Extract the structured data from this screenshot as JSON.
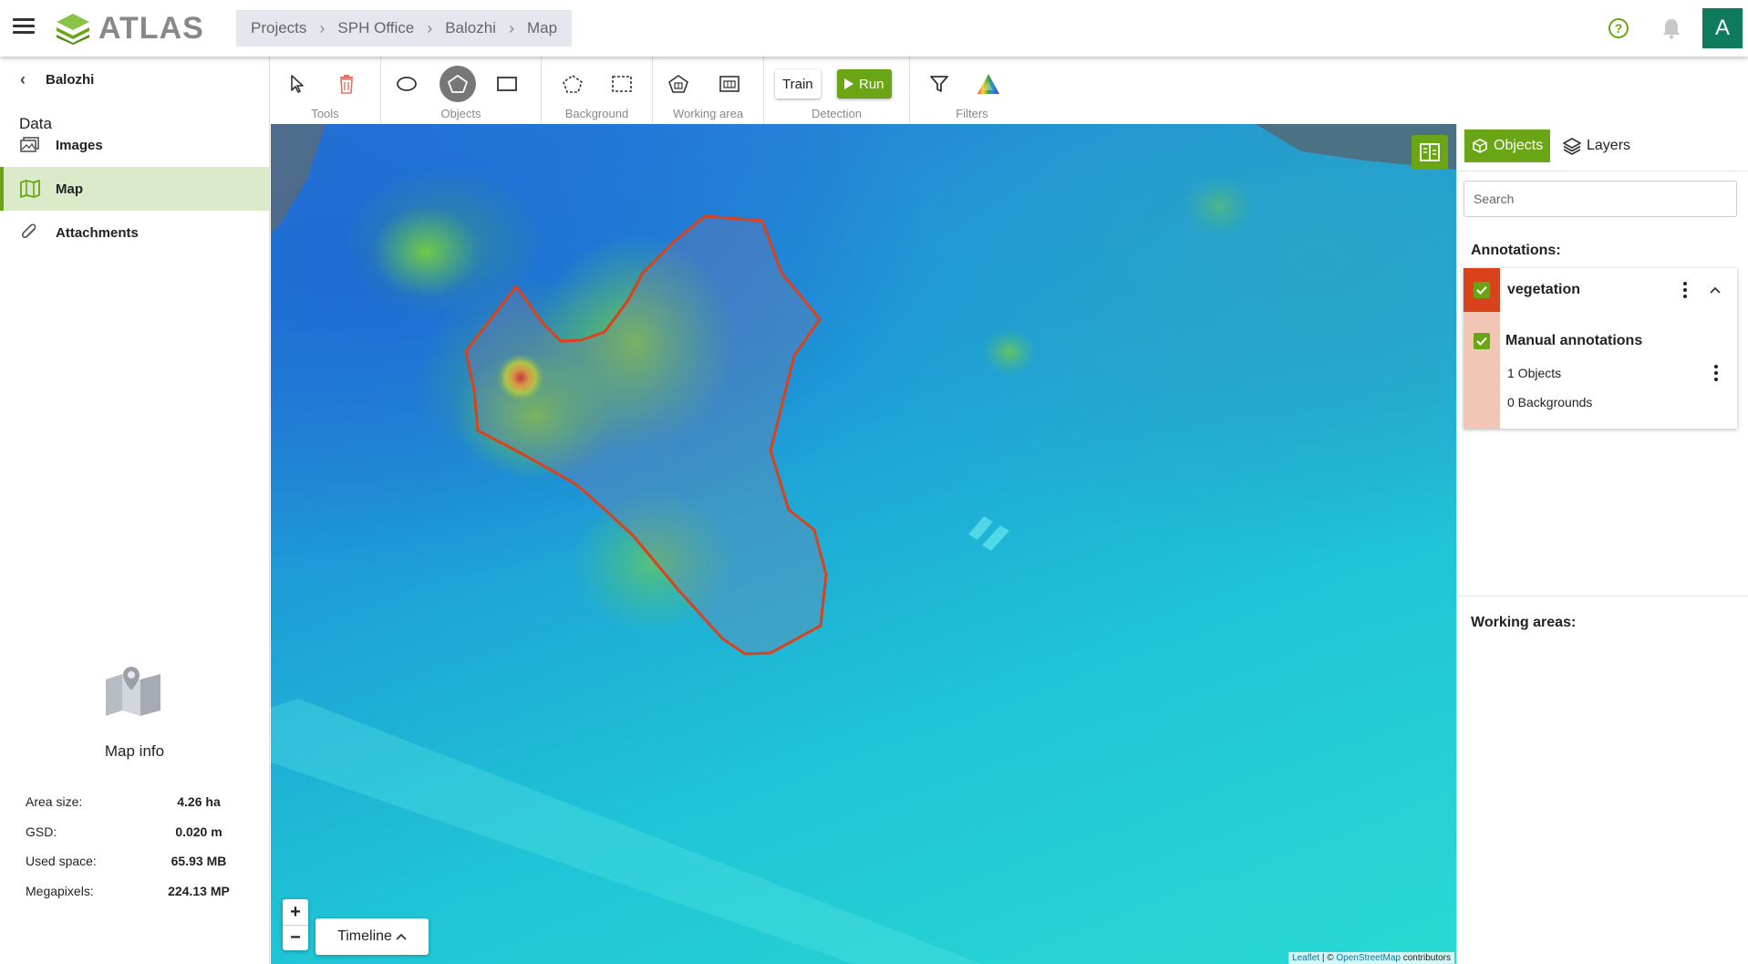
{
  "header": {
    "logo_text": "ATLAS",
    "breadcrumb": [
      "Projects",
      "SPH Office",
      "Balozhi",
      "Map"
    ],
    "help_icon": "help-circle-icon",
    "bell_icon": "bell-icon",
    "avatar_letter": "A",
    "accent_color": "#6aa515"
  },
  "sidebar": {
    "back_label": "Balozhi",
    "section_title": "Data",
    "items": [
      {
        "label": "Images",
        "icon": "images-icon",
        "active": false
      },
      {
        "label": "Map",
        "icon": "map-icon",
        "active": true
      },
      {
        "label": "Attachments",
        "icon": "paperclip-icon",
        "active": false
      }
    ],
    "map_info": {
      "title": "Map info",
      "stats": [
        {
          "label": "Area size:",
          "value": "4.26 ha"
        },
        {
          "label": "GSD:",
          "value": "0.020 m"
        },
        {
          "label": "Used space:",
          "value": "65.93 MB"
        },
        {
          "label": "Megapixels:",
          "value": "224.13 MP"
        }
      ]
    }
  },
  "toolbar": {
    "groups": {
      "tools": "Tools",
      "objects": "Objects",
      "background": "Background",
      "working_area": "Working area",
      "detection": "Detection",
      "filters": "Filters"
    },
    "train_label": "Train",
    "run_label": "Run"
  },
  "map": {
    "zoom_in": "+",
    "zoom_out": "−",
    "timeline_label": "Timeline",
    "attribution": {
      "leaflet": "Leaflet",
      "sep": " | © ",
      "osm": "OpenStreetMap",
      "suffix": " contributors"
    },
    "annotation_color": "#d9431c"
  },
  "right_panel": {
    "tabs": {
      "objects": "Objects",
      "layers": "Layers"
    },
    "search_placeholder": "Search",
    "annotations_title": "Annotations:",
    "annotation": {
      "name": "vegetation",
      "color": "#d9431c",
      "manual_label": "Manual annotations",
      "objects_count": "1 Objects",
      "backgrounds_count": "0 Backgrounds"
    },
    "working_areas_title": "Working areas:"
  }
}
